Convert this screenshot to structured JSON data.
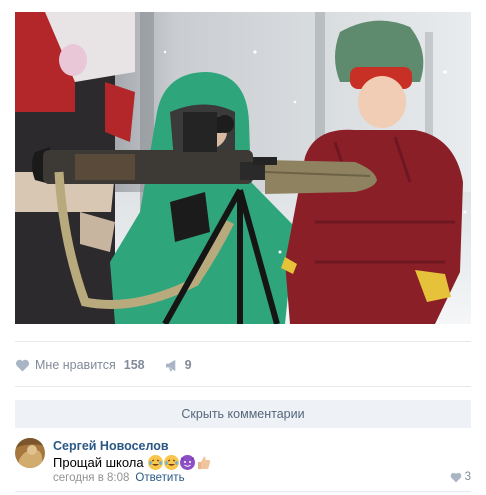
{
  "post": {
    "likes_label": "Мне нравится",
    "likes_count": "158",
    "shares_count": "9"
  },
  "comments": {
    "toggle_label": "Скрыть комментарии",
    "items": [
      {
        "author": "Сергей Новоселов",
        "text": "Прощай школа",
        "emoji_icons": [
          "laughing-tears-icon",
          "laughing-tears-icon",
          "smiling-imp-icon",
          "thumbs-up-icon"
        ],
        "time": "сегодня в 8:08",
        "reply_label": "Ответить",
        "likes": "3"
      }
    ]
  },
  "colors": {
    "link": "#2a5885",
    "muted": "#828a99",
    "button_bg": "#eef1f5"
  }
}
